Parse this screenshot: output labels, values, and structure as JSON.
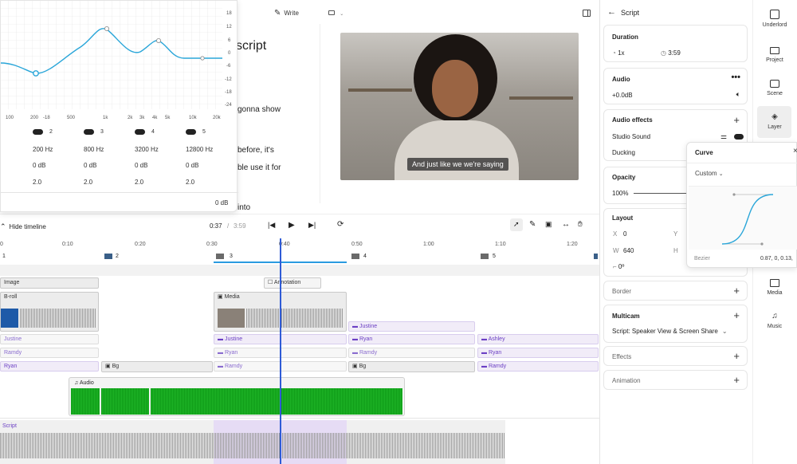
{
  "eq": {
    "db_ticks": [
      "18",
      "12",
      "6",
      "0",
      "-6",
      "-12",
      "-18",
      "-24"
    ],
    "freq_ticks": [
      "100",
      "200",
      "-18",
      "500",
      "1k",
      "2k",
      "3k",
      "4k",
      "5k",
      "10k",
      "20k"
    ],
    "bands": [
      {
        "num": "2",
        "freq": "200 Hz",
        "gain": "0 dB",
        "q": "2.0"
      },
      {
        "num": "3",
        "freq": "800 Hz",
        "gain": "0 dB",
        "q": "2.0"
      },
      {
        "num": "4",
        "freq": "3200 Hz",
        "gain": "0 dB",
        "q": "2.0"
      },
      {
        "num": "5",
        "freq": "12800 Hz",
        "gain": "0 dB",
        "q": "2.0"
      }
    ],
    "output": "0 dB"
  },
  "toolbar": {
    "write": "Write"
  },
  "script": {
    "title": "script",
    "lines": [
      "gonna show",
      "before, it's",
      "ble use it for",
      "into"
    ]
  },
  "video": {
    "caption": "And just like we we're saying"
  },
  "transport": {
    "hide": "Hide timeline",
    "current": "0:37",
    "sep": "/",
    "total": "3:59"
  },
  "ruler": [
    "0",
    "0:10",
    "0:20",
    "0:30",
    "0:40",
    "0:50",
    "1:00",
    "1:10",
    "1:20"
  ],
  "scenes": [
    "1",
    "2",
    "3",
    "4",
    "5"
  ],
  "tracks": {
    "image": "Image",
    "annotation": "Annotation",
    "broll": "B-roll",
    "media": "Media",
    "justine1": "Justine",
    "justine2": "Justine",
    "justine3": "Justine",
    "ashley": "Ashley",
    "ryan1": "Ryan",
    "ryan2": "Ryan",
    "ryan3": "Ryan",
    "ryan4": "Ryan",
    "ryan5": "Ryan",
    "ramdy1": "Ramdy",
    "ramdy2": "Ramdy",
    "ramdy3": "Ramdy",
    "ramdy4": "Ramdy",
    "bg1": "Bg",
    "bg2": "Bg",
    "audio": "Audio",
    "script": "Script"
  },
  "panel": {
    "title": "Script",
    "duration": {
      "label": "Duration",
      "speed": "1x",
      "time": "3:59"
    },
    "audio": {
      "label": "Audio",
      "gain": "+0.0dB"
    },
    "effects": {
      "label": "Audio effects",
      "studio": "Studio Sound",
      "ducking": "Ducking"
    },
    "opacity": {
      "label": "Opacity",
      "value": "100%"
    },
    "layout": {
      "label": "Layout",
      "x_lbl": "X",
      "x": "0",
      "y_lbl": "Y",
      "w_lbl": "W",
      "w": "640",
      "h_lbl": "H",
      "rot": "0º"
    },
    "border": "Border",
    "multicam": {
      "label": "Multicam",
      "value": "Script: Speaker View & Screen Share"
    },
    "effects2": "Effects",
    "animation": "Animation"
  },
  "curve": {
    "title": "Curve",
    "preset": "Custom",
    "bezier_lbl": "Bezier",
    "bezier": "0.87, 0, 0.13,"
  },
  "rail": [
    "Underlord",
    "Project",
    "Scene",
    "Layer",
    "Media",
    "Music"
  ],
  "colors": {
    "accent": "#2f5bd6",
    "purple": "#6b3fc4",
    "green": "#0e9b17",
    "eq": "#2aa6d9"
  }
}
